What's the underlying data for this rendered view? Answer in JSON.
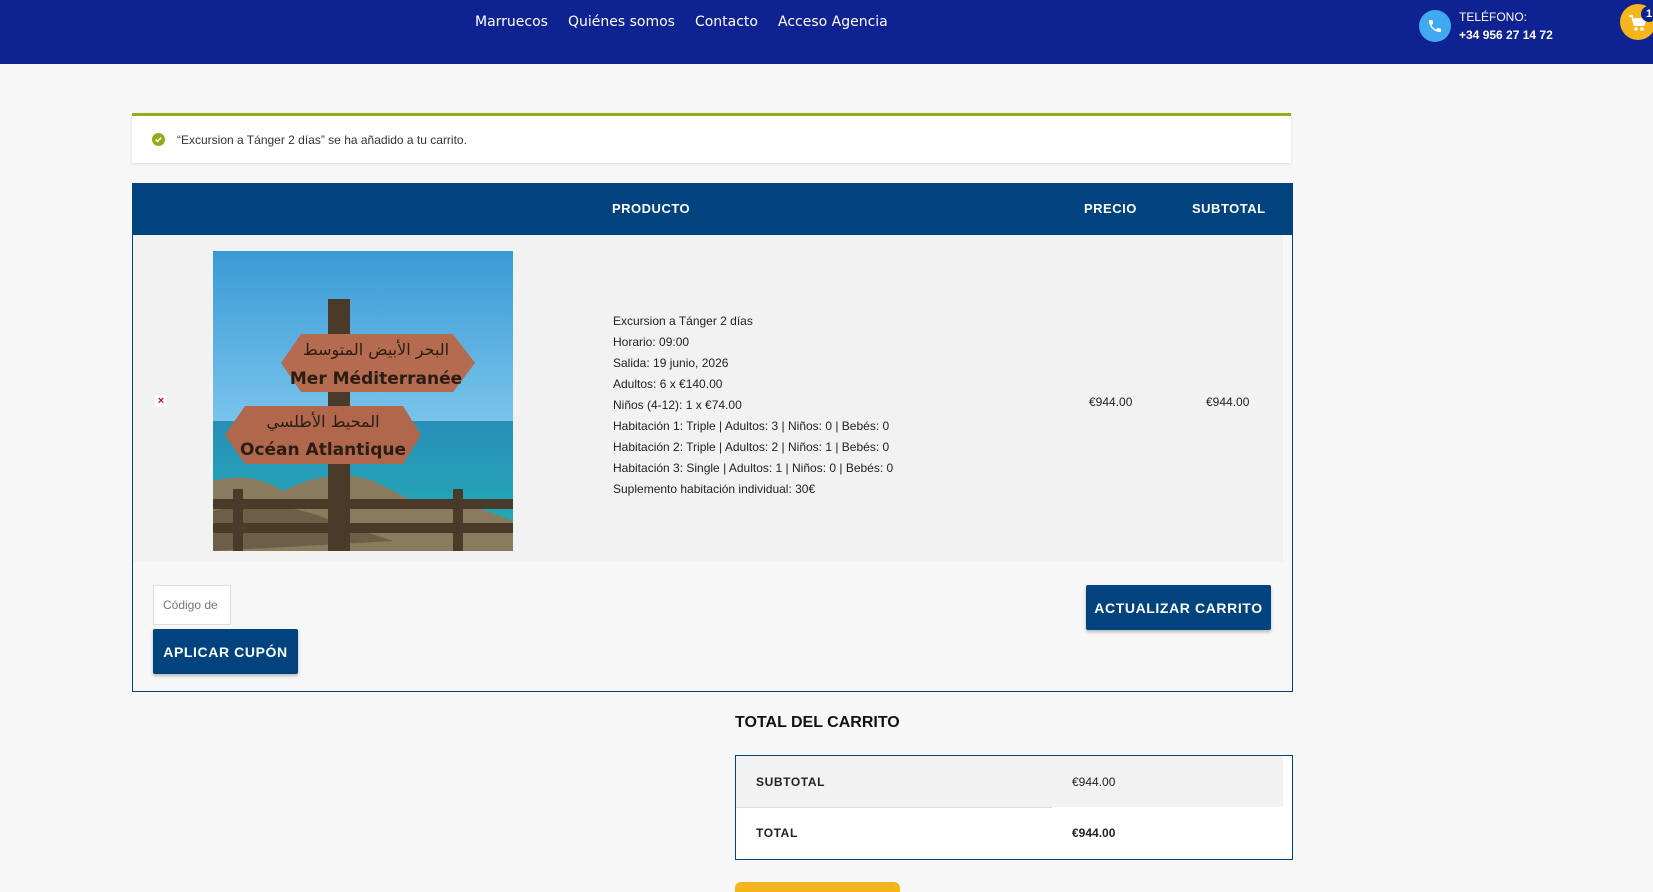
{
  "header": {
    "nav": [
      "Marruecos",
      "Quiénes somos",
      "Contacto",
      "Acceso Agencia"
    ],
    "phone_label": "TELÉFONO:",
    "phone_number": "+34 956 27 14 72",
    "cart_count": "1",
    "bg_color": "#0f2291"
  },
  "notice": {
    "text": "“Excursion a Tánger 2 días” se ha añadido a tu carrito."
  },
  "cart": {
    "columns": {
      "product": "PRODUCTO",
      "price": "PRECIO",
      "subtotal": "SUBTOTAL"
    },
    "item": {
      "remove": "×",
      "image_signs": [
        "البحر الأبيض المتوسط",
        "Mer Méditerranée",
        "المحيط الأطلسي",
        "Océan Atlantique"
      ],
      "details": [
        "Excursion a Tánger 2 días",
        "Horario: 09:00",
        "Salida: 19 junio, 2026",
        "Adultos: 6 x €140.00",
        "Niños (4-12): 1 x €74.00",
        "Habitación 1: Triple | Adultos: 3 | Niños: 0 | Bebés: 0",
        "Habitación 2: Triple | Adultos: 2 | Niños: 1 | Bebés: 0",
        "Habitación 3: Single | Adultos: 1 | Niños: 0 | Bebés: 0",
        "Suplemento habitación individual: 30€"
      ],
      "price": "€944.00",
      "subtotal": "€944.00"
    },
    "coupon_placeholder": "Código de cupón",
    "apply_coupon": "APLICAR CUPÓN",
    "update_cart": "ACTUALIZAR CARRITO",
    "accent_color": "#00437f"
  },
  "totals": {
    "title": "TOTAL DEL CARRITO",
    "subtotal_label": "SUBTOTAL",
    "subtotal_value": "€944.00",
    "total_label": "TOTAL",
    "total_value": "€944.00"
  }
}
